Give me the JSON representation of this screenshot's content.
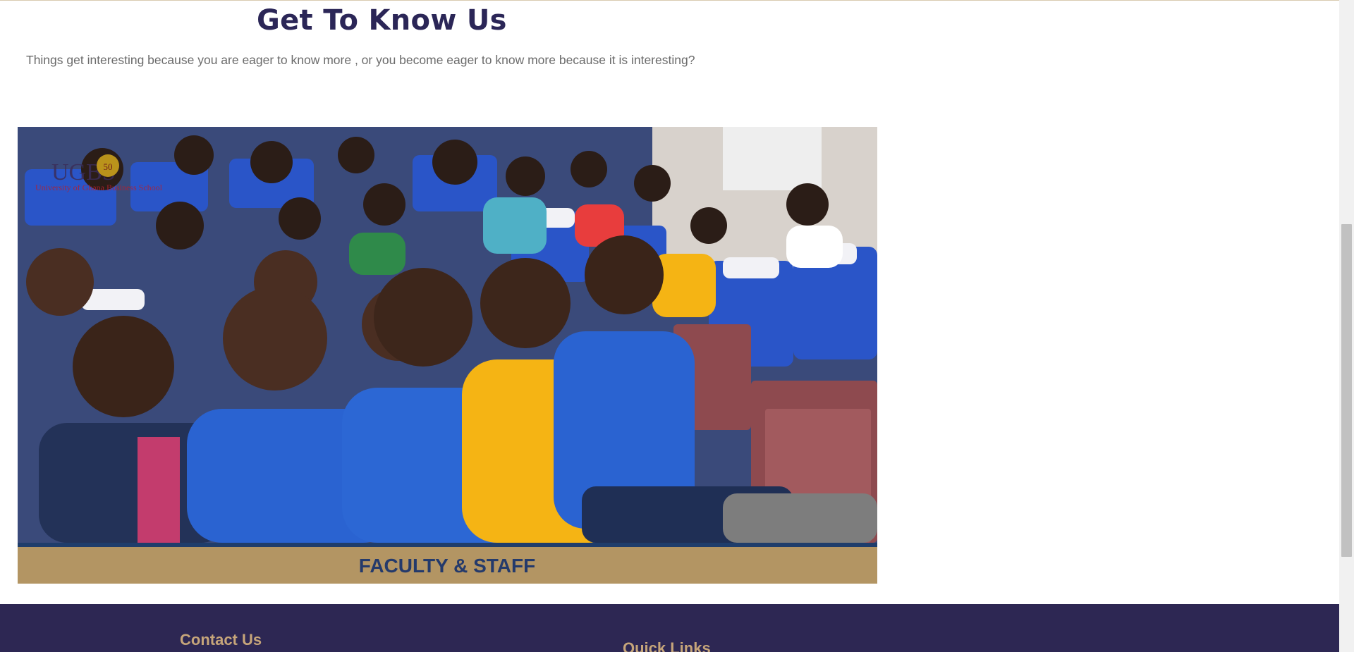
{
  "section": {
    "title": "Get To Know Us",
    "subtitle": "Things get interesting because you are eager to know more , or you become eager to know more because it is interesting?"
  },
  "hero_image": {
    "logo_text": "UGBS",
    "logo_badge": "50",
    "logo_subtitle": "University of Ghana Business School",
    "banner_text": "FACULTY & STAFF",
    "colors": {
      "banner": "#b39563",
      "banner_text": "#243a6b",
      "stripe": "#1f3d6b",
      "shirt_blue": "#2a63d1",
      "shirt_yellow": "#f5b414"
    }
  },
  "footer": {
    "contact_heading": "Contact Us",
    "quick_links_heading": "Quick Links"
  },
  "colors": {
    "title": "#2b2657",
    "footer_bg": "#2d2753",
    "footer_heading": "#c6a57a"
  }
}
